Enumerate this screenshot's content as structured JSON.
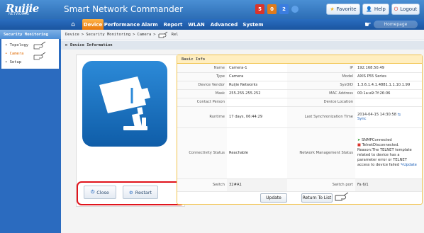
{
  "header": {
    "brand": "Ruijie",
    "brand_sub": "NETWORKS",
    "app_title": "Smart Network Commander",
    "alarm_counts": [
      "5",
      "0",
      "2"
    ],
    "alarm_colors": [
      "#d9342b",
      "#e07b1a",
      "#3b7de0"
    ],
    "favorite_label": "Favorite",
    "help_label": "Help",
    "logout_label": "Logout"
  },
  "nav": {
    "items": [
      "Device",
      "Performance",
      "Alarm",
      "Report",
      "WLAN",
      "Advanced",
      "System"
    ],
    "active": "Device",
    "back_label": "Homepage"
  },
  "sidebar": {
    "title": "Security Monitoring",
    "items": [
      {
        "label": "Topology",
        "active": false
      },
      {
        "label": "Camera",
        "active": true
      },
      {
        "label": "Setup",
        "active": false
      }
    ]
  },
  "breadcrumb": {
    "parts": [
      "Device",
      "Security Monitoring",
      "Camera",
      "Rel"
    ]
  },
  "section": {
    "title": "Device Information"
  },
  "actions": {
    "close_label": "Close",
    "restart_label": "Restart"
  },
  "info": {
    "title": "Basic Info",
    "rows": [
      {
        "l1": "Name",
        "v1": "Camera-1",
        "l2": "IP",
        "v2": "192.168.50.49"
      },
      {
        "l1": "Type",
        "v1": "Camera",
        "l2": "Model",
        "v2": "AXIS P55 Series"
      },
      {
        "l1": "Device Vendor",
        "v1": "Ruijie Networks",
        "l2": "SysOID",
        "v2": "1.3.6.1.4.1.4881.1.1.10.1.99"
      },
      {
        "l1": "Mask",
        "v1": "255.255.255.252",
        "l2": "MAC Address",
        "v2": "00:1a:a9:7f:26:06"
      },
      {
        "l1": "Contact Person",
        "v1": "",
        "l2": "Device Location",
        "v2": ""
      },
      {
        "l1": "Runtime",
        "v1": "17 days, 06:44:29",
        "l2": "Last Synchronization Time",
        "v2": "2014-04-15 14:30:58",
        "v2b": "Sync"
      },
      {
        "l1": "Connectivity Status",
        "v1": "Reachable",
        "l2": "Network Management Status",
        "snmp": "SNMPConnected",
        "telnet": "TelnetDisconnected.",
        "reason": "Reason:The TELNET template related to device has a parameter error or TELNET access to device failed",
        "update_link": "Update"
      },
      {
        "l1": "Switch",
        "v1": "32#A1",
        "l2": "Switch port",
        "v2": "Fa 6/1"
      }
    ],
    "update_button": "Update",
    "return_button": "Return To List"
  }
}
